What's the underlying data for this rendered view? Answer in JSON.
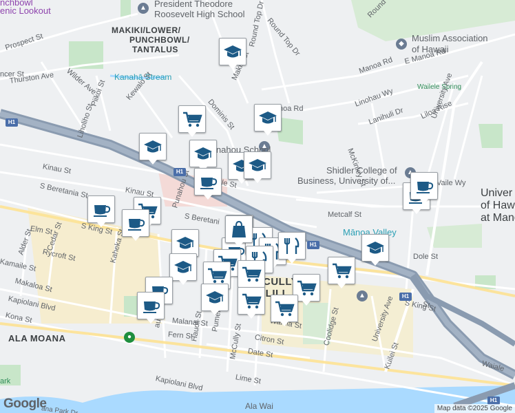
{
  "map": {
    "neighborhoods": [
      {
        "id": "makiki",
        "text": "MAKIKI/LOWER/"
      },
      {
        "id": "punchbowl",
        "text": "PUNCHBOWL/"
      },
      {
        "id": "tantalus",
        "text": "TANTALUS"
      },
      {
        "id": "ala-moana",
        "text": "ALA MOANA"
      },
      {
        "id": "mccully",
        "text": "CULLY"
      },
      {
        "id": "moiliili",
        "text": "ILILI"
      }
    ],
    "pois": [
      {
        "id": "roosevelt",
        "text": "President Theodore"
      },
      {
        "id": "roosevelt2",
        "text": "Roosevelt High School"
      },
      {
        "id": "muslim",
        "text": "Muslim Association"
      },
      {
        "id": "muslim2",
        "text": "of Hawaii"
      },
      {
        "id": "punahou",
        "text": "Punahou School"
      },
      {
        "id": "shidler",
        "text": "Shidler College of"
      },
      {
        "id": "shidler2",
        "text": "Business, University of..."
      },
      {
        "id": "univ1",
        "text": "Univer"
      },
      {
        "id": "univ2",
        "text": "of Hawa"
      },
      {
        "id": "univ3",
        "text": "at Mano"
      },
      {
        "id": "lookout1",
        "text": "nchbowl"
      },
      {
        "id": "lookout2",
        "text": "enic Lookout"
      }
    ],
    "water_labels": [
      {
        "id": "kanaha",
        "text": "Kanahā Stream"
      },
      {
        "id": "manoa-valley",
        "text": "Mānoa Valley"
      }
    ],
    "park_labels": [
      {
        "id": "wailele",
        "text": "Wailele Spring"
      }
    ],
    "streets": [
      {
        "id": "prospect",
        "text": "Prospect St"
      },
      {
        "id": "thurston",
        "text": "Thurston Ave"
      },
      {
        "id": "spencer",
        "text": "ncer St"
      },
      {
        "id": "wilder",
        "text": "Wilder Ave"
      },
      {
        "id": "piikoi",
        "text": "Piikoi St"
      },
      {
        "id": "kewalo",
        "text": "Kewalo St"
      },
      {
        "id": "liholiho",
        "text": "Liholiho St"
      },
      {
        "id": "dominis",
        "text": "Dominis St"
      },
      {
        "id": "makikist",
        "text": "Makiki St"
      },
      {
        "id": "roundtop",
        "text": "Round Top Dr"
      },
      {
        "id": "roundtop2",
        "text": "Round Top Dr"
      },
      {
        "id": "roundtop3",
        "text": "Round"
      },
      {
        "id": "manoard",
        "text": "Manoa Rd"
      },
      {
        "id": "emanoa",
        "text": "E Manoa Rd"
      },
      {
        "id": "manoard2",
        "text": "noa Rd"
      },
      {
        "id": "linohau",
        "text": "Linohau Wy"
      },
      {
        "id": "lanihuli",
        "text": "Lanihuli Dr"
      },
      {
        "id": "liloa",
        "text": "Liloa Rise"
      },
      {
        "id": "mckinley",
        "text": "McKinley St"
      },
      {
        "id": "universityave",
        "text": "University Ave"
      },
      {
        "id": "kinau",
        "text": "Kinau St"
      },
      {
        "id": "kinau2",
        "text": "Kinau St"
      },
      {
        "id": "beretania",
        "text": "S Beretania St"
      },
      {
        "id": "beretania2",
        "text": "S Beretani"
      },
      {
        "id": "wilderst",
        "text": "ole St"
      },
      {
        "id": "punahou",
        "text": "Punahou St"
      },
      {
        "id": "sking",
        "text": "S King St"
      },
      {
        "id": "sking2",
        "text": "S King St"
      },
      {
        "id": "elm",
        "text": "Elm St"
      },
      {
        "id": "cedar",
        "text": "Cedar St"
      },
      {
        "id": "alder",
        "text": "Alder St"
      },
      {
        "id": "rycroft",
        "text": "Rycroft St"
      },
      {
        "id": "kamaile",
        "text": "Kamaile St"
      },
      {
        "id": "makaloa",
        "text": "Makaloa St"
      },
      {
        "id": "kaheka",
        "text": "Kaheka St"
      },
      {
        "id": "kapiolani",
        "text": "Kapiolani Blvd"
      },
      {
        "id": "kapiolani2",
        "text": "Kapiolani Blvd"
      },
      {
        "id": "kona",
        "text": "Kona St"
      },
      {
        "id": "malanai",
        "text": "Malanai St"
      },
      {
        "id": "fern",
        "text": "Fern St"
      },
      {
        "id": "hauoli",
        "text": "Hauoli St"
      },
      {
        "id": "pumehana",
        "text": "Pumehana St"
      },
      {
        "id": "mccullyst",
        "text": "McCully St"
      },
      {
        "id": "citron",
        "text": "Citron St"
      },
      {
        "id": "date",
        "text": "Date St"
      },
      {
        "id": "lime",
        "text": "Lime St"
      },
      {
        "id": "waiola",
        "text": "Waiola St"
      },
      {
        "id": "coolidge",
        "text": "Coolidge St"
      },
      {
        "id": "metcalf",
        "text": "Metcalf St"
      },
      {
        "id": "dole",
        "text": "Dole St"
      },
      {
        "id": "univave2",
        "text": "University Ave"
      },
      {
        "id": "kuilei",
        "text": "Kuilei St"
      },
      {
        "id": "waiale",
        "text": "Waiale"
      },
      {
        "id": "wailewy",
        "text": "Vaile Wy"
      },
      {
        "id": "alawai",
        "text": "Ala Wai"
      },
      {
        "id": "atkinson",
        "text": "ana Park Dr"
      },
      {
        "id": "lst",
        "text": "St"
      },
      {
        "id": "akm",
        "text": "aua Ave"
      },
      {
        "id": "rk",
        "text": "ark"
      }
    ],
    "shields": [
      {
        "id": "h1a",
        "text": "H1"
      },
      {
        "id": "h1b",
        "text": "H1"
      },
      {
        "id": "h1c",
        "text": "H1"
      },
      {
        "id": "h1d",
        "text": "H1"
      },
      {
        "id": "h1e",
        "text": "H1"
      }
    ],
    "markers": [
      {
        "id": "m1",
        "kind": "school"
      },
      {
        "id": "m2",
        "kind": "grocery"
      },
      {
        "id": "m3",
        "kind": "school"
      },
      {
        "id": "m4",
        "kind": "school"
      },
      {
        "id": "m5",
        "kind": "school"
      },
      {
        "id": "m6",
        "kind": "school"
      },
      {
        "id": "m7",
        "kind": "school"
      },
      {
        "id": "m8",
        "kind": "cafe"
      },
      {
        "id": "m9",
        "kind": "cafe"
      },
      {
        "id": "m10",
        "kind": "grocery"
      },
      {
        "id": "m11",
        "kind": "cafe"
      },
      {
        "id": "m12",
        "kind": "school"
      },
      {
        "id": "m13",
        "kind": "school"
      },
      {
        "id": "m14",
        "kind": "cafe"
      },
      {
        "id": "m15",
        "kind": "cafe"
      },
      {
        "id": "m16",
        "kind": "grocery"
      },
      {
        "id": "m17",
        "kind": "cafe"
      },
      {
        "id": "m18",
        "kind": "restaurant"
      },
      {
        "id": "m19",
        "kind": "restaurant"
      },
      {
        "id": "m20",
        "kind": "restaurant"
      },
      {
        "id": "m21",
        "kind": "restaurant"
      },
      {
        "id": "m22",
        "kind": "restaurant"
      },
      {
        "id": "m23",
        "kind": "grocery"
      },
      {
        "id": "m24",
        "kind": "grocery"
      },
      {
        "id": "m25",
        "kind": "grocery"
      },
      {
        "id": "m26",
        "kind": "school"
      },
      {
        "id": "m27",
        "kind": "grocery"
      },
      {
        "id": "m28",
        "kind": "grocery"
      },
      {
        "id": "m29",
        "kind": "grocery"
      },
      {
        "id": "m30",
        "kind": "grocery"
      },
      {
        "id": "m31",
        "kind": "school"
      },
      {
        "id": "m32",
        "kind": "cafe"
      },
      {
        "id": "m33",
        "kind": "shopping"
      },
      {
        "id": "m34",
        "kind": "cafe"
      }
    ],
    "colors": {
      "marker_icon": "#1d5a86",
      "freeway": "#8a9bb0",
      "water": "#aadaff",
      "park": "#c8e6c9",
      "highlight": "#f7e7b9"
    }
  },
  "footer": {
    "logo": "Google",
    "attribution": "Map data ©2025 Google"
  }
}
